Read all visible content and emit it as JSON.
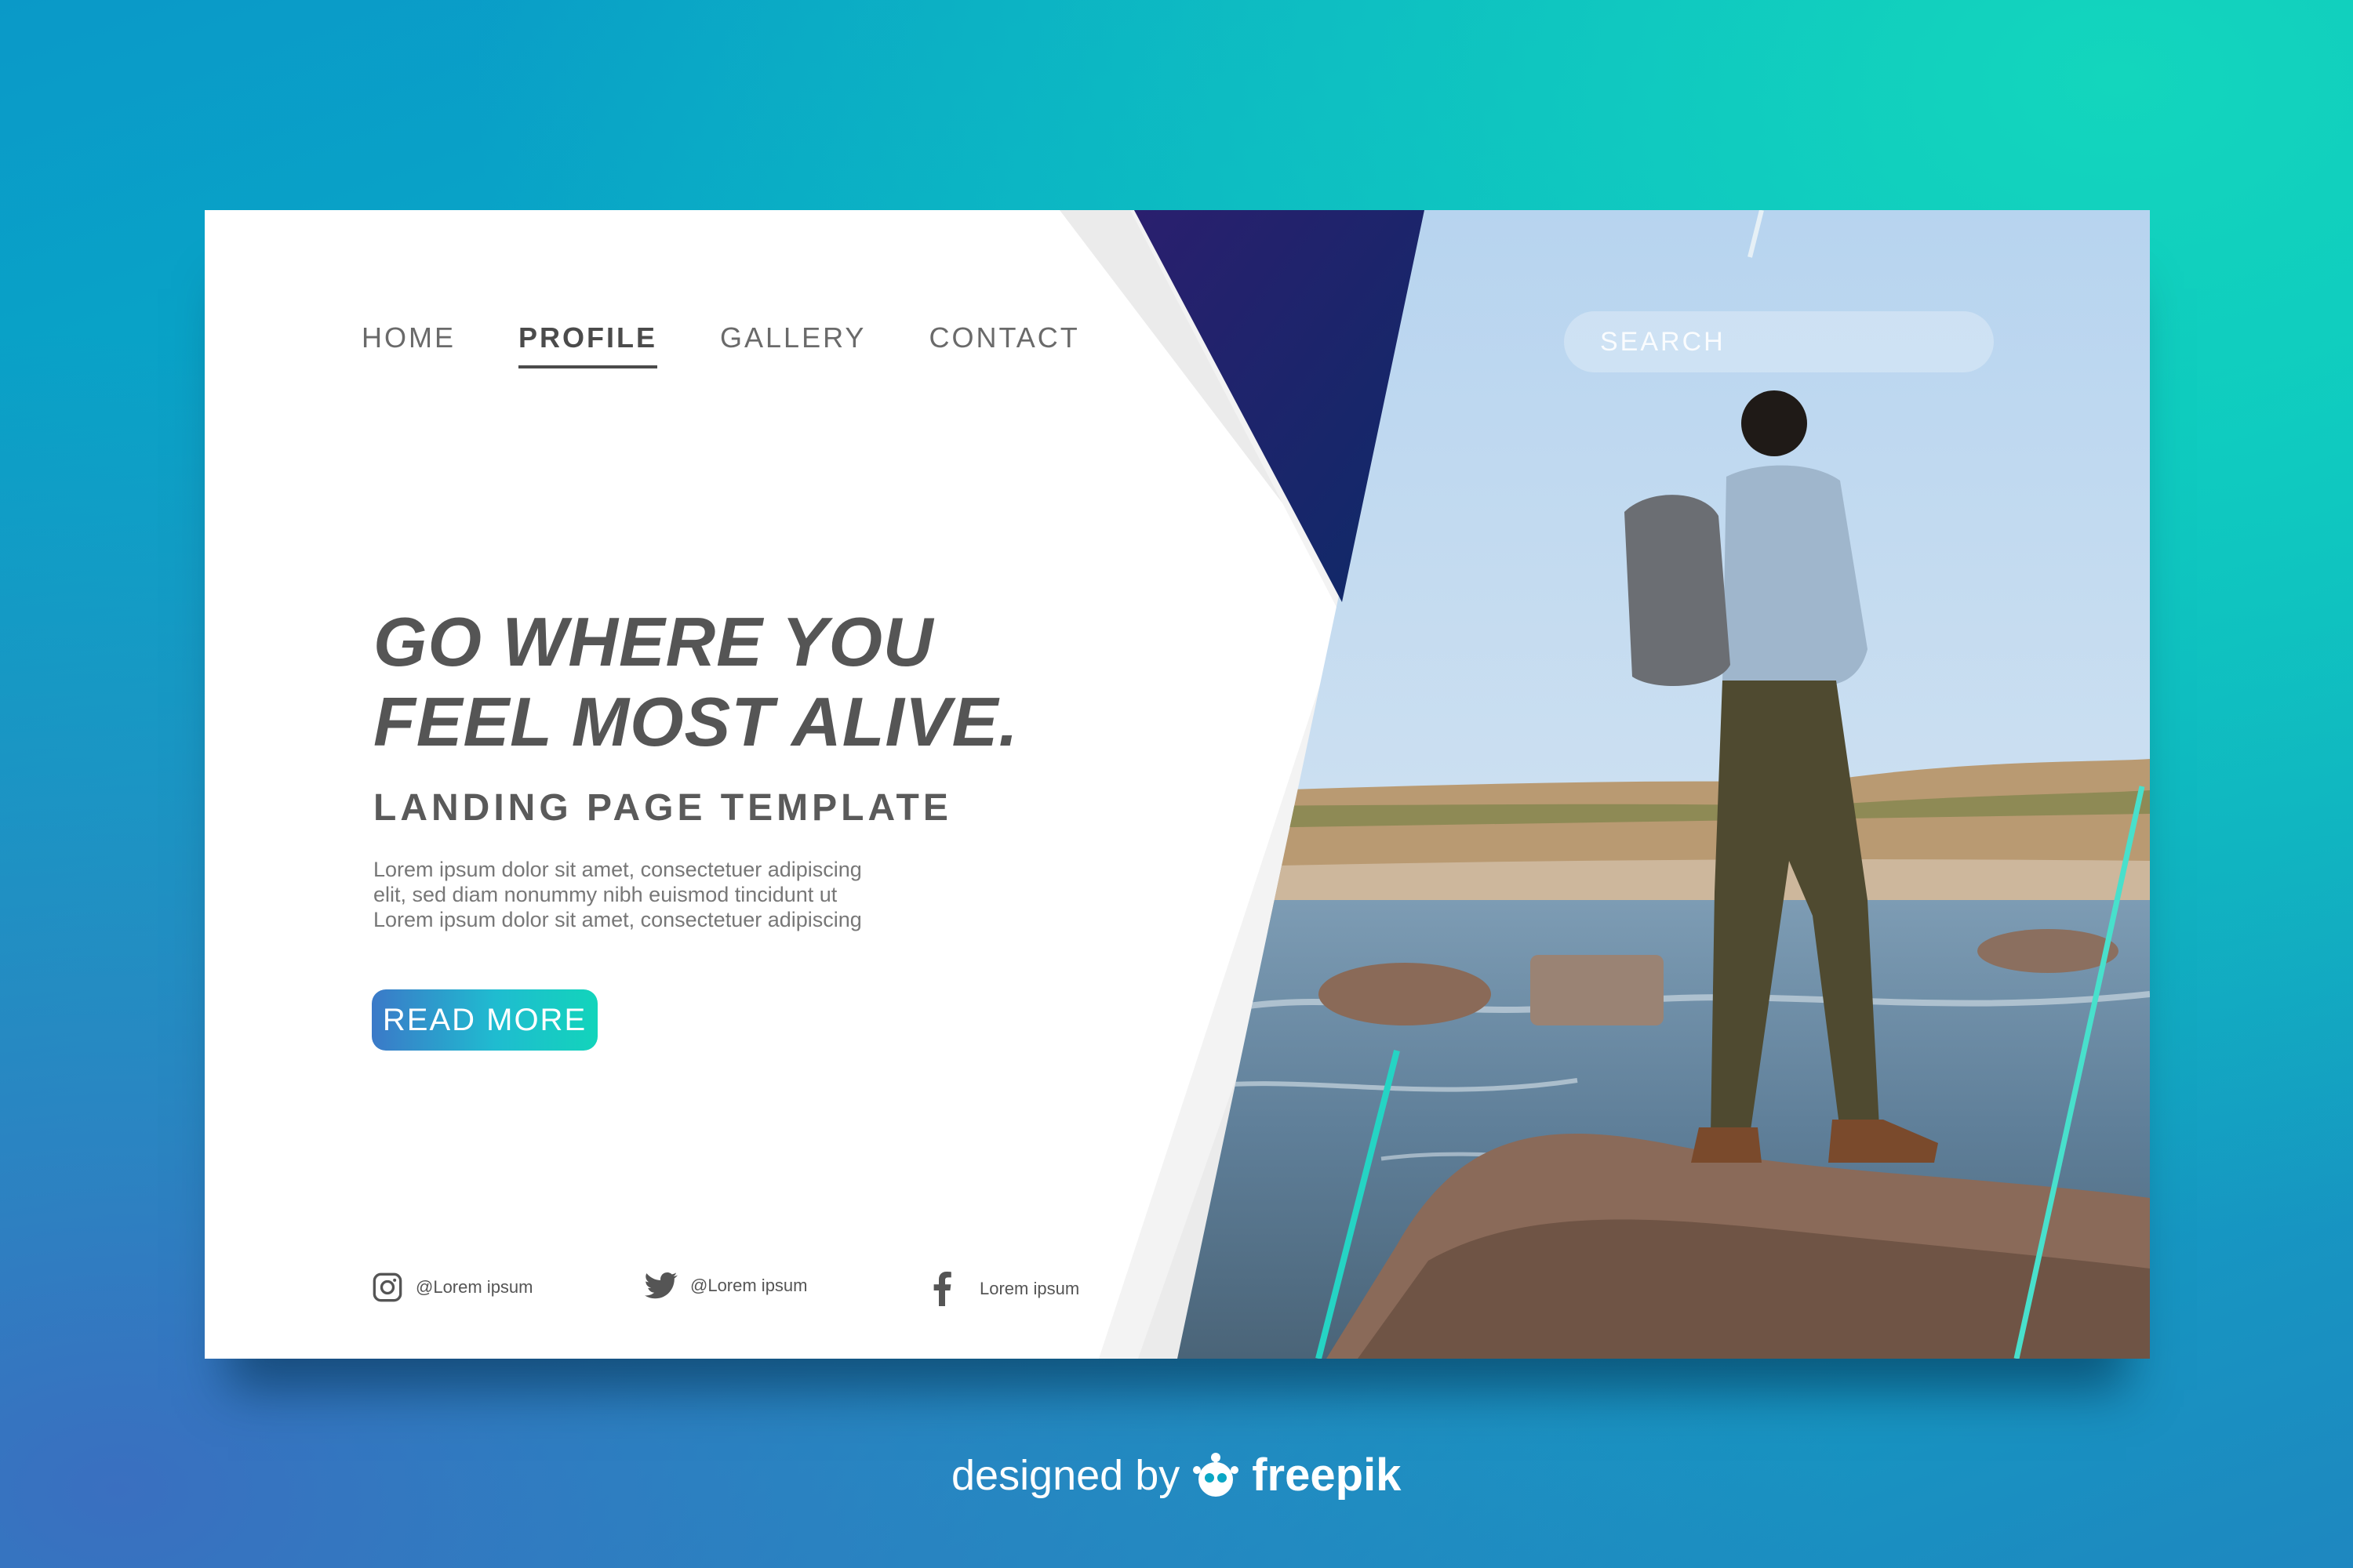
{
  "nav": {
    "items": [
      {
        "label": "HOME",
        "active": false
      },
      {
        "label": "PROFILE",
        "active": true
      },
      {
        "label": "GALLERY",
        "active": false
      },
      {
        "label": "CONTACT",
        "active": false
      }
    ]
  },
  "search": {
    "placeholder": "SEARCH"
  },
  "hero": {
    "headline_line1": "GO WHERE YOU",
    "headline_line2": "FEEL MOST ALIVE.",
    "subtitle": "LANDING PAGE TEMPLATE",
    "body_line1": "Lorem ipsum dolor sit amet, consectetuer adipiscing",
    "body_line2": "elit, sed diam nonummy nibh euismod tincidunt ut",
    "body_line3": "Lorem ipsum dolor sit amet, consectetuer adipiscing",
    "cta_label": "READ MORE"
  },
  "social": {
    "instagram": {
      "label": "@Lorem ipsum",
      "icon": "instagram-icon"
    },
    "twitter": {
      "label": "@Lorem ipsum",
      "icon": "twitter-icon"
    },
    "facebook": {
      "label": "Lorem ipsum",
      "icon": "facebook-icon"
    }
  },
  "credit": {
    "prefix": "designed by",
    "brand": "freepik"
  },
  "colors": {
    "accent_start": "#3b79c8",
    "accent_end": "#12d4bb",
    "navy_triangle": "#1c1f5e",
    "text_dark": "#555555"
  }
}
